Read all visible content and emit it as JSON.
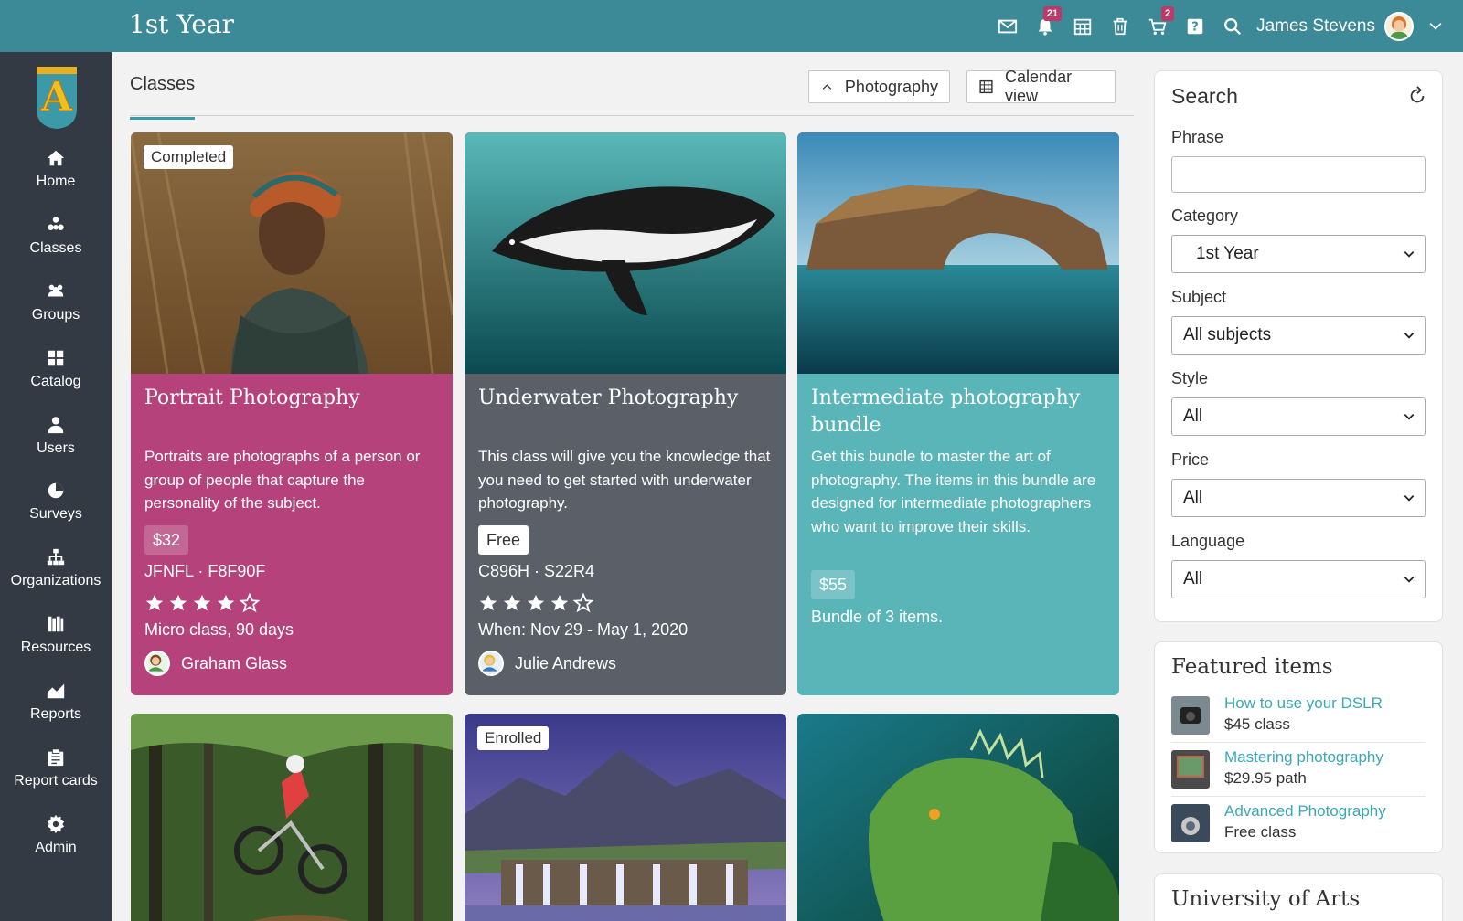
{
  "header": {
    "title": "1st Year",
    "notifications_count": "21",
    "cart_count": "2",
    "user_name": "James Stevens"
  },
  "sidebar": {
    "logo_letter": "A",
    "items": [
      {
        "label": "Home",
        "icon": "home-icon"
      },
      {
        "label": "Classes",
        "icon": "classes-icon"
      },
      {
        "label": "Groups",
        "icon": "groups-icon"
      },
      {
        "label": "Catalog",
        "icon": "catalog-icon"
      },
      {
        "label": "Users",
        "icon": "user-icon"
      },
      {
        "label": "Surveys",
        "icon": "surveys-icon"
      },
      {
        "label": "Organizations",
        "icon": "organizations-icon"
      },
      {
        "label": "Resources",
        "icon": "resources-icon"
      },
      {
        "label": "Reports",
        "icon": "reports-icon"
      },
      {
        "label": "Report cards",
        "icon": "report-cards-icon"
      },
      {
        "label": "Admin",
        "icon": "gear-icon"
      }
    ]
  },
  "main": {
    "tab_label": "Classes",
    "filter_button": "Photography",
    "calendar_button": "Calendar view",
    "cards": [
      {
        "title": "Portrait Photography",
        "status": "Completed",
        "description": "Portraits are photographs of a person or group of people that capture the personality of the subject.",
        "price": "$32",
        "code": "JFNFL · F8F90F",
        "rating": 4,
        "meta": "Micro class, 90 days",
        "instructor": "Graham Glass",
        "color": "#b5427a"
      },
      {
        "title": "Underwater Photography",
        "description": "This class will give you the knowledge that you need to get started with underwater photography.",
        "price": "Free",
        "code": "C896H · S22R4",
        "rating": 4,
        "meta": "When: Nov 29 - May 1, 2020",
        "instructor": "Julie Andrews",
        "color": "#5b6068"
      },
      {
        "title": "Intermediate photography bundle",
        "description": "Get this bundle to master the art of photography. The items in this bundle are designed for intermediate photographers who want to improve their skills.",
        "price": "$55",
        "meta": "Bundle of 3 items.",
        "color": "#5ab5b8"
      },
      {
        "status": ""
      },
      {
        "status": "Enrolled"
      },
      {
        "status": ""
      }
    ]
  },
  "search": {
    "title": "Search",
    "phrase_label": "Phrase",
    "phrase_value": "",
    "category_label": "Category",
    "category_value": "1st Year",
    "subject_label": "Subject",
    "subject_value": "All subjects",
    "style_label": "Style",
    "style_value": "All",
    "price_label": "Price",
    "price_value": "All",
    "language_label": "Language",
    "language_value": "All"
  },
  "featured": {
    "title": "Featured items",
    "items": [
      {
        "title": "How to use your DSLR",
        "sub": "$45 class"
      },
      {
        "title": "Mastering photography",
        "sub": "$29.95 path"
      },
      {
        "title": "Advanced Photography",
        "sub": "Free class"
      }
    ]
  },
  "university": {
    "title": "University of Arts"
  },
  "colors": {
    "topbar": "#3c8a98",
    "sidebar": "#333a44",
    "accent": "#3aa8b8",
    "badge": "#c03868"
  }
}
